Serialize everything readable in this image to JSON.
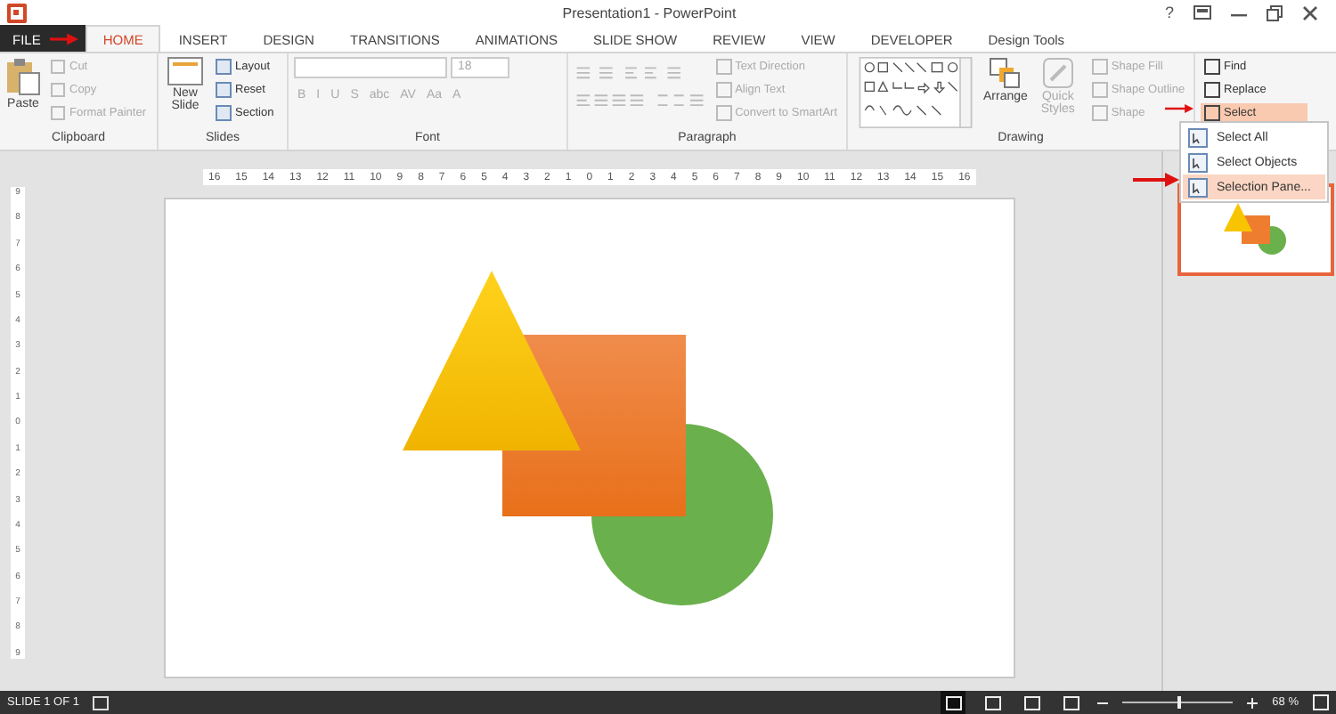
{
  "window": {
    "title": "Presentation1 - PowerPoint",
    "help": "?"
  },
  "tabs": [
    {
      "label": "FILE",
      "selected": false,
      "kind": "file"
    },
    {
      "label": "HOME",
      "selected": true,
      "kind": "tab"
    },
    {
      "label": "INSERT",
      "selected": false,
      "kind": "tab"
    },
    {
      "label": "DESIGN",
      "selected": false,
      "kind": "tab"
    },
    {
      "label": "TRANSITIONS",
      "selected": false,
      "kind": "tab"
    },
    {
      "label": "ANIMATIONS",
      "selected": false,
      "kind": "tab"
    },
    {
      "label": "SLIDE SHOW",
      "selected": false,
      "kind": "tab"
    },
    {
      "label": "REVIEW",
      "selected": false,
      "kind": "tab"
    },
    {
      "label": "VIEW",
      "selected": false,
      "kind": "tab"
    },
    {
      "label": "DEVELOPER",
      "selected": false,
      "kind": "tab"
    },
    {
      "label": "Design Tools",
      "selected": false,
      "kind": "context"
    }
  ],
  "ribbon": {
    "clipboard": {
      "label": "Clipboard",
      "paste": "Paste",
      "items": [
        {
          "label": "Cut",
          "disabled": true
        },
        {
          "label": "Copy",
          "disabled": true
        },
        {
          "label": "Format Painter",
          "disabled": true
        }
      ]
    },
    "slides": {
      "label": "Slides",
      "new_slide": "New Slide",
      "items": [
        {
          "label": "Layout",
          "disabled": false
        },
        {
          "label": "Reset",
          "disabled": false
        },
        {
          "label": "Section",
          "disabled": false
        }
      ]
    },
    "font": {
      "label": "Font",
      "size": "18",
      "buttons": [
        "B",
        "I",
        "U",
        "S",
        "abc",
        "AV",
        "Aa",
        "A"
      ]
    },
    "paragraph": {
      "label": "Paragraph",
      "items": [
        {
          "label": "Text Direction",
          "disabled": true
        },
        {
          "label": "Align Text",
          "disabled": true
        },
        {
          "label": "Convert to SmartArt",
          "disabled": true
        }
      ]
    },
    "drawing": {
      "label": "Drawing",
      "arrange": "Arrange",
      "quick_styles": "Quick Styles",
      "quick_styles_disabled": true,
      "items": [
        {
          "label": "Shape Fill",
          "disabled": true
        },
        {
          "label": "Shape Outline",
          "disabled": true
        },
        {
          "label": "Shape",
          "disabled": true
        }
      ]
    },
    "editing": {
      "items": [
        {
          "label": "Find",
          "selected": false
        },
        {
          "label": "Replace",
          "selected": false
        },
        {
          "label": "Select",
          "selected": true
        }
      ]
    }
  },
  "select_menu": [
    {
      "label": "Select All",
      "selected": false
    },
    {
      "label": "Select Objects",
      "selected": false
    },
    {
      "label": "Selection Pane...",
      "selected": true
    }
  ],
  "ruler": {
    "horizontal": [
      "16",
      "15",
      "14",
      "13",
      "12",
      "11",
      "10",
      "9",
      "8",
      "7",
      "6",
      "5",
      "4",
      "3",
      "2",
      "1",
      "0",
      "1",
      "2",
      "3",
      "4",
      "5",
      "6",
      "7",
      "8",
      "9",
      "10",
      "11",
      "12",
      "13",
      "14",
      "15",
      "16"
    ],
    "vertical": [
      "9",
      "8",
      "7",
      "6",
      "5",
      "4",
      "3",
      "2",
      "1",
      "0",
      "1",
      "2",
      "3",
      "4",
      "5",
      "6",
      "7",
      "8",
      "9"
    ]
  },
  "thumbnail": {
    "selected": true
  },
  "status_bar": {
    "slide": "SLIDE 1 OF 1",
    "zoom": {
      "level": 0.5,
      "reading": "68 %"
    },
    "views": [
      {
        "selected": true
      },
      {
        "selected": false
      },
      {
        "selected": false
      },
      {
        "selected": false
      }
    ]
  }
}
